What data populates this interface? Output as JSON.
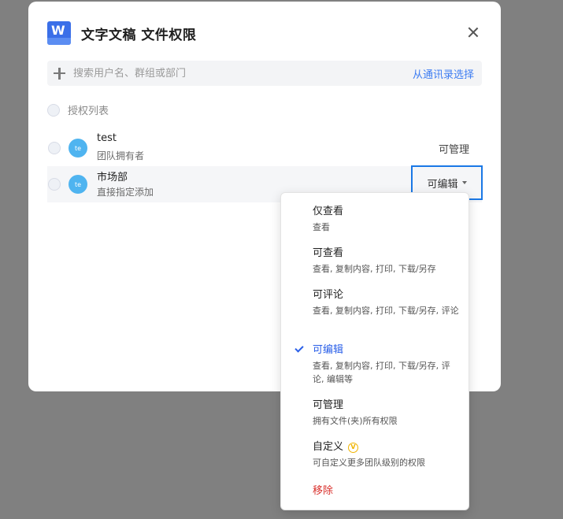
{
  "dialog": {
    "app_icon_letter": "W",
    "title": "文字文稿 文件权限",
    "search_placeholder": "搜索用户名、群组或部门",
    "contacts_link": "从通讯录选择",
    "list_header": "授权列表",
    "members": [
      {
        "name": "test",
        "sub": "团队拥有者",
        "avatar_text": "te",
        "permission": "可管理"
      },
      {
        "name": "市场部",
        "sub": "直接指定添加",
        "avatar_text": "te",
        "permission": "可编辑"
      }
    ]
  },
  "menu": {
    "items": [
      {
        "label": "仅查看",
        "desc": "查看"
      },
      {
        "label": "可查看",
        "desc": "查看, 复制内容, 打印, 下载/另存"
      },
      {
        "label": "可评论",
        "desc": "查看, 复制内容, 打印, 下载/另存, 评论"
      },
      {
        "label": "可编辑",
        "desc": "查看, 复制内容, 打印, 下载/另存, 评论, 编辑等",
        "selected": true
      },
      {
        "label": "可管理",
        "desc": "拥有文件(夹)所有权限"
      },
      {
        "label": "自定义",
        "desc": "可自定义更多团队级别的权限"
      }
    ],
    "vip_badge": "V",
    "remove_label": "移除"
  },
  "colors": {
    "accent": "#3d7cf2",
    "selected_text": "#2a5fe8",
    "danger": "#d9302c",
    "focus_border": "#1a78e6",
    "vip": "#f0b400"
  }
}
